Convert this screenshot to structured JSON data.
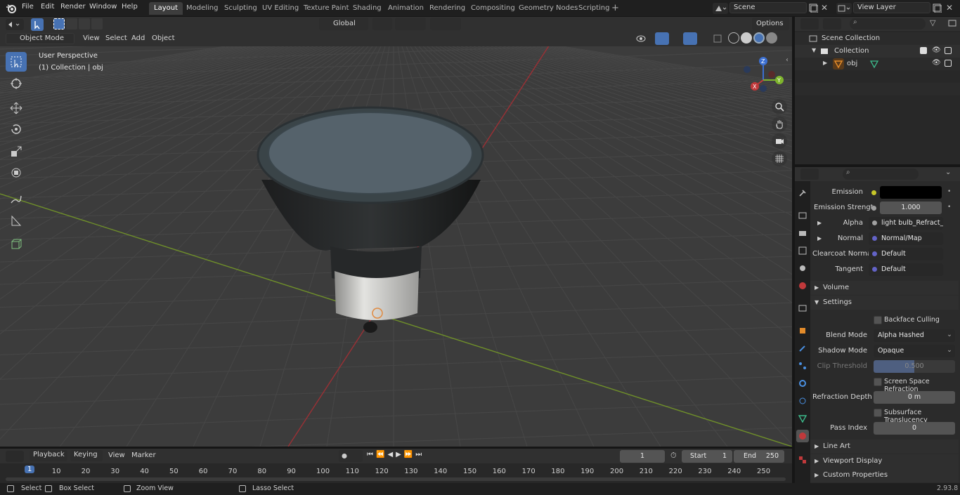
{
  "menus": [
    "File",
    "Edit",
    "Render",
    "Window",
    "Help"
  ],
  "workspaces": [
    "Layout",
    "Modeling",
    "Sculpting",
    "UV Editing",
    "Texture Paint",
    "Shading",
    "Animation",
    "Rendering",
    "Compositing",
    "Geometry Nodes",
    "Scripting"
  ],
  "active_workspace": "Layout",
  "scene_name": "Scene",
  "view_layer": "View Layer",
  "viewport_header": {
    "mode": "Object Mode",
    "menus": [
      "View",
      "Select",
      "Add",
      "Object"
    ],
    "orientation": "Global",
    "options": "Options"
  },
  "viewport_overlay": {
    "perspective": "User Perspective",
    "collection": "(1) Collection | obj"
  },
  "gizmo": {
    "z": "Z",
    "y": "Y",
    "x": "X"
  },
  "outliner": {
    "scene_collection": "Scene Collection",
    "collection": "Collection",
    "object": "obj"
  },
  "properties": {
    "emission_label": "Emission",
    "emission_strength_label": "Emission Strengt",
    "emission_strength_value": "1.000",
    "alpha_label": "Alpha",
    "alpha_value": "light bulb_Refract_in...",
    "normal_label": "Normal",
    "normal_value": "Normal/Map",
    "clearcoat_label": "Clearcoat Normal",
    "clearcoat_value": "Default",
    "tangent_label": "Tangent",
    "tangent_value": "Default",
    "volume_panel": "Volume",
    "settings_panel": "Settings",
    "backface_culling": "Backface Culling",
    "blend_mode_label": "Blend Mode",
    "blend_mode_value": "Alpha Hashed",
    "shadow_mode_label": "Shadow Mode",
    "shadow_mode_value": "Opaque",
    "clip_threshold_label": "Clip Threshold",
    "clip_threshold_value": "0.500",
    "clip_threshold_fraction": 0.5,
    "ssr_label": "Screen Space Refraction",
    "refraction_depth_label": "Refraction Depth",
    "refraction_depth_value": "0 m",
    "subsurface_label": "Subsurface Translucency",
    "pass_index_label": "Pass Index",
    "pass_index_value": "0",
    "line_art_panel": "Line Art",
    "viewport_display_panel": "Viewport Display",
    "custom_props_panel": "Custom Properties"
  },
  "timeline": {
    "menus": [
      "Playback",
      "Keying",
      "View",
      "Marker"
    ],
    "current_frame": "1",
    "start_label": "Start",
    "start_value": "1",
    "end_label": "End",
    "end_value": "250",
    "frame_labels": [
      "1",
      "10",
      "20",
      "30",
      "40",
      "50",
      "60",
      "70",
      "80",
      "90",
      "100",
      "110",
      "120",
      "130",
      "140",
      "150",
      "160",
      "170",
      "180",
      "190",
      "200",
      "210",
      "220",
      "230",
      "240",
      "250"
    ]
  },
  "statusbar": {
    "select": "Select",
    "box_select": "Box Select",
    "zoom_view": "Zoom View",
    "lasso_select": "Lasso Select",
    "version": "2.93.8"
  },
  "colors": {
    "accent": "#4772b3",
    "x_axis": "#c0393b",
    "y_axis": "#7fb52d",
    "z_axis": "#3b6fd1",
    "object_orange": "#e38b2a"
  }
}
